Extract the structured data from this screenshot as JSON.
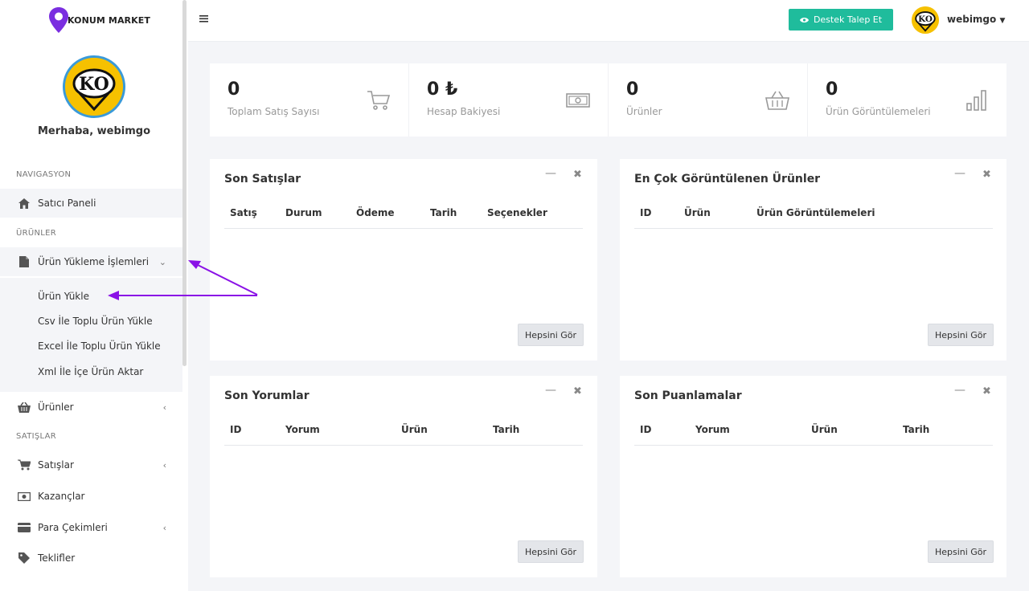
{
  "brand": {
    "logo_text": "KONUM MARKET",
    "avatar_text": "KO"
  },
  "sidebar": {
    "greeting": "Merhaba, webimgo",
    "sections": {
      "navigation": "NAVIGASYON",
      "products": "ÜRÜNLER",
      "sales": "SATIŞLAR"
    },
    "items": {
      "dashboard": "Satıcı Paneli",
      "upload_ops": "Ürün Yükleme İşlemleri",
      "products": "Ürünler",
      "sales": "Satışlar",
      "earnings": "Kazançlar",
      "withdrawals": "Para Çekimleri",
      "offers": "Teklifler"
    },
    "submenu": [
      "Ürün Yükle",
      "Csv İle Toplu Ürün Yükle",
      "Excel İle Toplu Ürün Yükle",
      "Xml İle İçe Ürün Aktar"
    ]
  },
  "topbar": {
    "support_label": "Destek Talep Et",
    "username": "webimgo"
  },
  "stats": [
    {
      "value": "0",
      "label": "Toplam Satış Sayısı",
      "icon": "cart-icon"
    },
    {
      "value": "0 ₺",
      "label": "Hesap Bakiyesi",
      "icon": "money-icon"
    },
    {
      "value": "0",
      "label": "Ürünler",
      "icon": "basket-icon"
    },
    {
      "value": "0",
      "label": "Ürün Görüntülemeleri",
      "icon": "bar-chart-icon"
    }
  ],
  "cards": {
    "latest_sales": {
      "title": "Son Satışlar",
      "columns": [
        "Satış",
        "Durum",
        "Ödeme",
        "Tarih",
        "Seçenekler"
      ]
    },
    "most_viewed": {
      "title": "En Çok Görüntülenen Ürünler",
      "columns": [
        "ID",
        "Ürün",
        "Ürün Görüntülemeleri"
      ]
    },
    "latest_reviews": {
      "title": "Son Yorumlar",
      "columns": [
        "ID",
        "Yorum",
        "Ürün",
        "Tarih"
      ]
    },
    "latest_ratings": {
      "title": "Son Puanlamalar",
      "columns": [
        "ID",
        "Yorum",
        "Ürün",
        "Tarih"
      ]
    },
    "see_all_label": "Hepsini Gör",
    "minimize_glyph": "—",
    "close_glyph": "✖"
  },
  "colors": {
    "accent": "#1fbc9c",
    "annotation": "#8a11e6",
    "logo_purple": "#7a2ee0",
    "avatar_yellow": "#f6c100"
  }
}
